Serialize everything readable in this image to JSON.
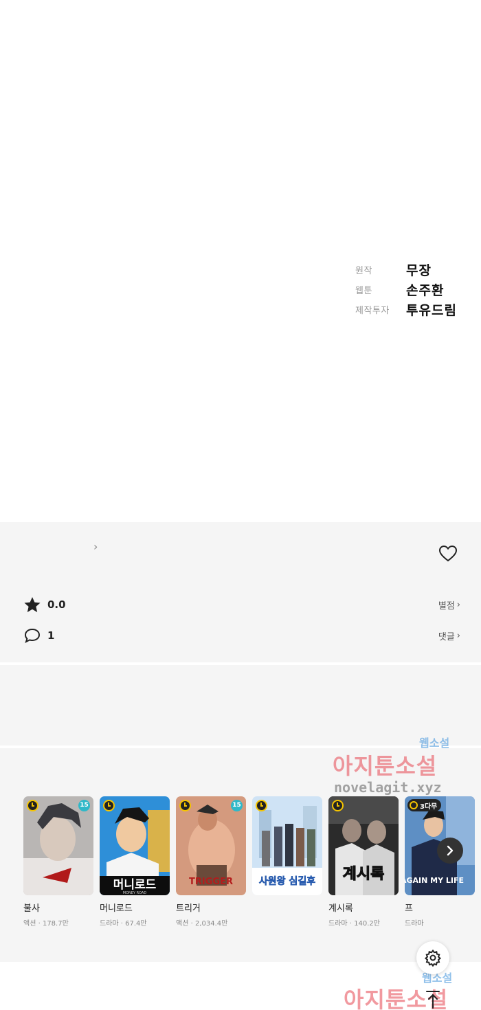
{
  "credits": [
    {
      "role": "원작",
      "name": "무장"
    },
    {
      "role": "웹툰",
      "name": "손주환"
    },
    {
      "role": "제작투자",
      "name": "투유드림"
    }
  ],
  "stats": {
    "rating_value": "0.0",
    "rating_link": "별점",
    "comment_count": "1",
    "comment_link": "댓글"
  },
  "recommendations": [
    {
      "title": "불사",
      "genre": "액션",
      "views": "178.7만",
      "age_badge": "15"
    },
    {
      "title": "머니로드",
      "genre": "드라마",
      "views": "67.4만",
      "cover_text": "머니로드",
      "cover_subtext": "MONEY ROAD"
    },
    {
      "title": "트리거",
      "genre": "액션",
      "views": "2,034.4만",
      "age_badge": "15",
      "cover_text": "TRIGGER"
    },
    {
      "title": "",
      "genre": "",
      "views": "",
      "cover_text": "사원왕 심길후"
    },
    {
      "title": "계시록",
      "genre": "드라마",
      "views": "140.2만",
      "cover_text": "계시록"
    },
    {
      "title": "프",
      "genre": "드라마",
      "views": "",
      "wait_badge": "3다무",
      "cover_text": "AGAIN MY LIFE"
    }
  ],
  "watermark": {
    "small": "웹소설",
    "main": "아지툰소설",
    "url": "novelagit.xyz"
  },
  "icons": {
    "heart": "heart-outline-icon",
    "star": "star-icon",
    "comment": "comment-bubble-icon",
    "next": "chevron-right-icon",
    "settings": "gear-icon",
    "top": "arrow-up-icon"
  }
}
